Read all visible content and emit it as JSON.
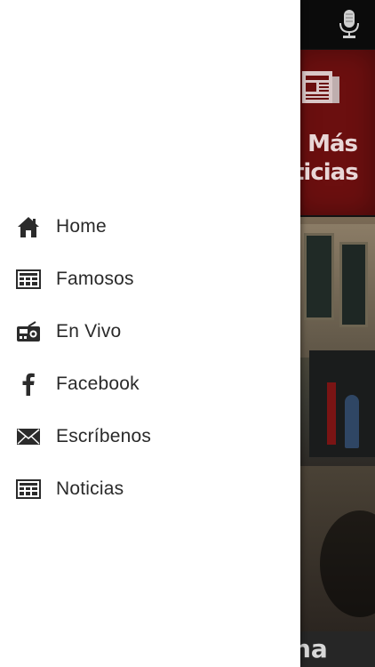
{
  "background": {
    "tile_label": "Más\nticias",
    "bottom_cut_text": "na",
    "colors": {
      "tile": "#6b0f0f",
      "top_bar": "#0b0b0b"
    }
  },
  "drawer": {
    "items": [
      {
        "label": "Home",
        "icon": "home-icon"
      },
      {
        "label": "Famosos",
        "icon": "newspaper-icon"
      },
      {
        "label": "En Vivo",
        "icon": "radio-icon"
      },
      {
        "label": "Facebook",
        "icon": "facebook-icon"
      },
      {
        "label": "Escríbenos",
        "icon": "envelope-icon"
      },
      {
        "label": "Noticias",
        "icon": "newspaper-icon"
      }
    ]
  }
}
